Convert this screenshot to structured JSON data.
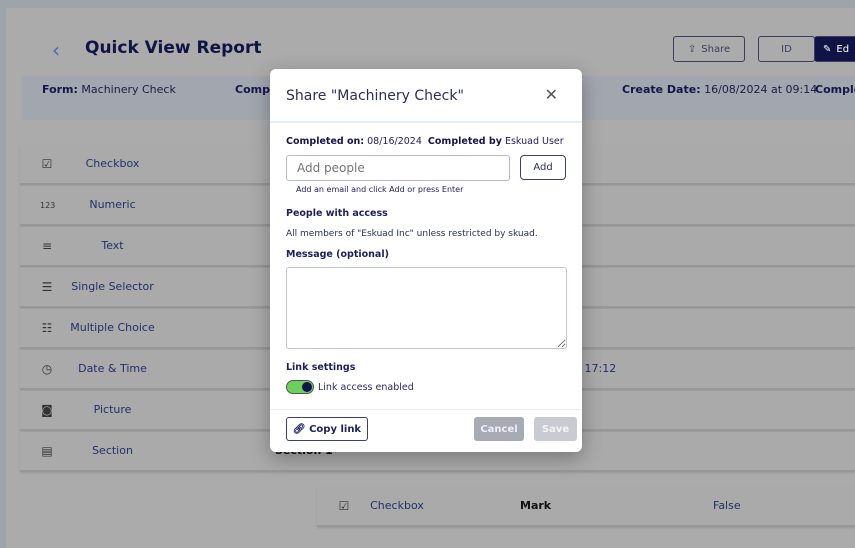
{
  "header": {
    "title": "Quick View Report",
    "share": "Share",
    "id": "ID",
    "edit": "Ed"
  },
  "meta": {
    "form_label": "Form:",
    "form_value": "Machinery Check",
    "comp_label": "Comp",
    "create_label": "Create Date:",
    "create_value": "16/08/2024 at 09:14",
    "comple_label": "Comple"
  },
  "rows": [
    {
      "icon": "checkbox-icon",
      "label": "Checkbox",
      "val": "✓"
    },
    {
      "icon": "numeric-icon",
      "label": "Numeric",
      "val": "✓"
    },
    {
      "icon": "text-icon",
      "label": "Text",
      "val": "✓"
    },
    {
      "icon": "single-selector-icon",
      "label": "Single Selector",
      "val": ""
    },
    {
      "icon": "multiple-choice-icon",
      "label": "Multiple Choice",
      "val": "✓"
    },
    {
      "icon": "date-time-icon",
      "label": "Date & Time",
      "val": "at 17:12"
    },
    {
      "icon": "camera-icon",
      "label": "Picture",
      "val": "✓"
    },
    {
      "icon": "section-icon",
      "label": "Section",
      "val": "Section 1"
    }
  ],
  "subrow": {
    "label": "Checkbox",
    "name": "Mark",
    "value": "False"
  },
  "modal": {
    "title": "Share \"Machinery Check\"",
    "completed_on_label": "Completed on:",
    "completed_on": "08/16/2024",
    "completed_by_label": "Completed by",
    "completed_by": "Eskuad User",
    "add_placeholder": "Add people",
    "add_button": "Add",
    "hint": "Add an email and click Add or press Enter",
    "access_title": "People with access",
    "access_text": "All members of \"Eskuad Inc\" unless restricted by skuad.",
    "message_label": "Message (optional)",
    "link_settings": "Link settings",
    "link_toggle": "Link access enabled",
    "link_enabled": true,
    "copy_link": "Copy link",
    "cancel": "Cancel",
    "save": "Save"
  }
}
